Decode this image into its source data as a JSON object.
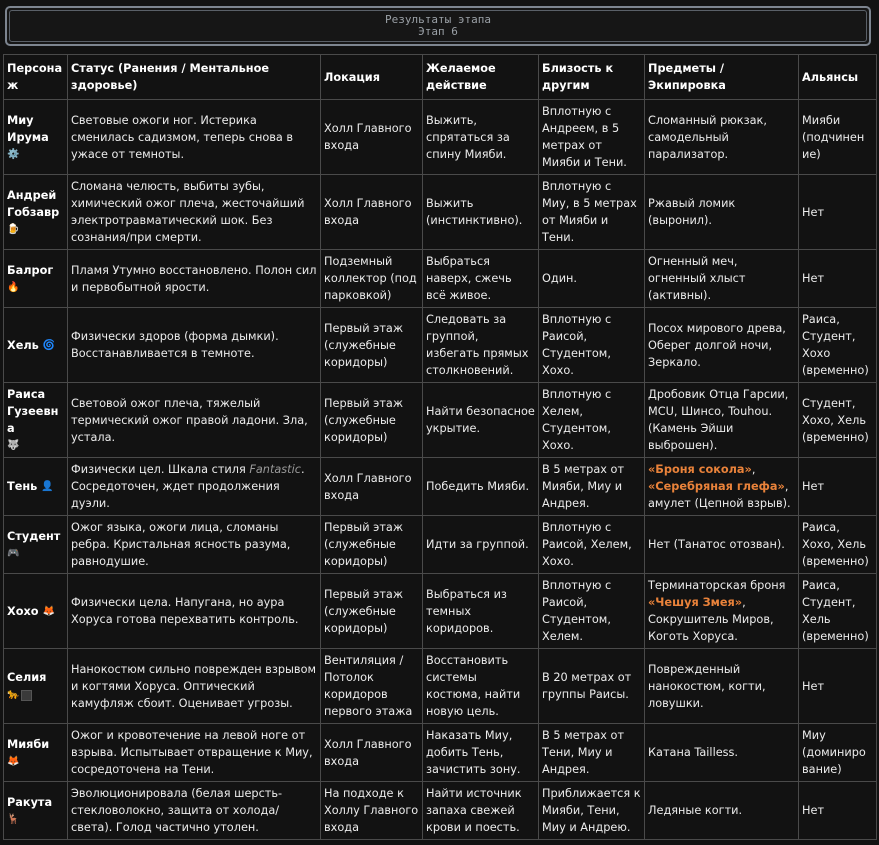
{
  "header": {
    "title": "Результаты этапа",
    "subtitle": "Этап 6"
  },
  "table": {
    "columns": [
      "Персона\nж",
      "Статус (Ранения / Ментальное здоровье)",
      "Локация",
      "Желаемое действие",
      "Близость к другим",
      "Предметы / Экипировка",
      "Альянсы"
    ],
    "rows": [
      {
        "name": "Миу Ирума",
        "emoji": "⚙️",
        "status": "Световые ожоги ног. Истерика сменилась садизмом, теперь снова в ужасе от темноты.",
        "location": "Холл Главного входа",
        "action": "Выжить, спрятаться за спину Мияби.",
        "proximity": "Вплотную с Андреем, в 5 метрах от Мияби и Тени.",
        "items": "Сломанный рюкзак, самодельный парализатор.",
        "alliances": "Мияби (подчинен ие)"
      },
      {
        "name": "Андрей Гобзавр",
        "emoji": "🍺",
        "status": "Сломана челюсть, выбиты зубы, химический ожог плеча, жесточайший электротравматический шок. Без сознания/при смерти.",
        "location": "Холл Главного входа",
        "action": "Выжить (инстинктивно).",
        "proximity": "Вплотную с Миу, в 5 метрах от Мияби и Тени.",
        "items": "Ржавый ломик (выронил).",
        "alliances": "Нет"
      },
      {
        "name": "Балрог",
        "emoji": "🔥",
        "status": "Пламя Утумно восстановлено. Полон сил и первобытной ярости.",
        "location": "Подземный коллектор (под парковкой)",
        "action": "Выбраться наверх, сжечь всё живое.",
        "proximity": "Один.",
        "items": "Огненный меч, огненный хлыст (активны).",
        "alliances": "Нет"
      },
      {
        "name": "Хель",
        "emoji": "🌀",
        "status": "Физически здоров (форма дымки). Восстанавливается в темноте.",
        "location": "Первый этаж (служебные коридоры)",
        "action": "Следовать за группой, избегать прямых столкновений.",
        "proximity": "Вплотную с Раисой, Студентом, Хохо.",
        "items": "Посох мирового древа, Оберег долгой ночи, Зеркало.",
        "alliances": "Раиса, Студент, Хохо (временно)"
      },
      {
        "name": "Раиса Гузеевна",
        "emoji": "🐺",
        "status": "Световой ожог плеча, тяжелый термический ожог правой ладони. Зла, устала.",
        "location": "Первый этаж (служебные коридоры)",
        "action": "Найти безопасное укрытие.",
        "proximity": "Вплотную с Хелем, Студентом, Хохо.",
        "items": "Дробовик Отца Гарсии, MCU, Шинсо, Touhou. (Камень Эйши выброшен).",
        "alliances": "Студент, Хохо, Хель (временно)"
      },
      {
        "name": "Тень",
        "emoji": "👤",
        "status_before": "Физически цел. Шкала стиля ",
        "status_italic": "Fantastic",
        "status_after": ". Сосредоточен, ждет продолжения дуэли.",
        "location": "Холл Главного входа",
        "action": "Победить Мияби.",
        "proximity": "В 5 метрах от Мияби, Миу и Андрея.",
        "items_orange1": "«Броня сокола»",
        "items_sep": ",",
        "items_orange2": "«Серебряная глефа»",
        "items_after": ", амулет (Цепной взрыв).",
        "alliances": "Нет"
      },
      {
        "name": "Студент",
        "emoji": "🎮",
        "status": "Ожог языка, ожоги лица, сломаны ребра. Кристальная ясность разума, равнодушие.",
        "location": "Первый этаж (служебные коридоры)",
        "action": "Идти за группой.",
        "proximity": "Вплотную с Раисой, Хелем, Хохо.",
        "items": "Нет (Танатос отозван).",
        "alliances": "Раиса, Хохо, Хель (временно)"
      },
      {
        "name": "Хохо",
        "emoji": "🦊",
        "status": "Физически цела. Напугана, но аура Хоруса готова перехватить контроль.",
        "location": "Первый этаж (служебные коридоры)",
        "action": "Выбраться из темных коридоров.",
        "proximity": "Вплотную с Раисой, Студентом, Хелем.",
        "items_before": "Терминаторская броня ",
        "items_orange": "«Чешуя Змея»",
        "items_after": ", Сокрушитель Миров, Коготь Хоруса.",
        "alliances": "Раиса, Студент, Хель (временно)"
      },
      {
        "name": "Селия",
        "emoji": "🐆",
        "status": "Нанокостюм сильно поврежден взрывом и когтями Хоруса. Оптический камуфляж сбоит. Оценивает угрозы.",
        "location": "Вентиляция / Потолок коридоров первого этажа",
        "action": "Восстановить системы костюма, найти новую цель.",
        "proximity": "В 20 метрах от группы Раисы.",
        "items": "Поврежденный нанокостюм, когти, ловушки.",
        "alliances": "Нет"
      },
      {
        "name": "Мияби",
        "emoji": "🦊",
        "status": "Ожог и кровотечение на левой ноге от взрыва. Испытывает отвращение к Миу, сосредоточена на Тени.",
        "location": "Холл Главного входа",
        "action": "Наказать Миу, добить Тень, зачистить зону.",
        "proximity": "В 5 метрах от Тени, Миу и Андрея.",
        "items": "Катана Tailless.",
        "alliances": "Миу (доминиро вание)"
      },
      {
        "name": "Ракута",
        "emoji": "🦌",
        "status": "Эволюционировала (белая шерсть-стекловолокно, защита от холода/света). Голод частично утолен.",
        "location": "На подходе к Холлу Главного входа",
        "action": "Найти источник запаха свежей крови и поесть.",
        "proximity": "Приближается к Мияби, Тени, Миу и Андрею.",
        "items": "Ледяные когти.",
        "alliances": "Нет"
      }
    ]
  }
}
